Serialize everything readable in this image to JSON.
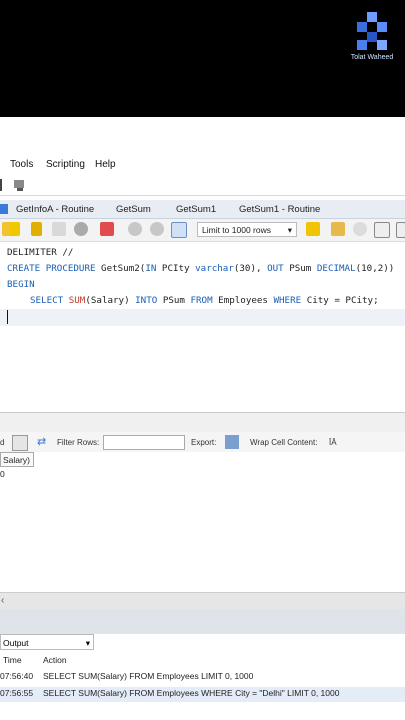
{
  "watermark": {
    "text": "Tolat Waheed"
  },
  "menu": {
    "items": [
      "Tools",
      "Scripting",
      "Help"
    ]
  },
  "tabs": [
    "GetInfoA - Routine",
    "GetSum",
    "GetSum1",
    "GetSum1 - Routine"
  ],
  "toolbar": {
    "limit_label": "Limit to 1000 rows",
    "limit_arrow": "▾"
  },
  "editor": {
    "line1": "DELIMITER //",
    "line2_kw1": "CREATE PROCEDURE",
    "line2_rest1": " GetSum2(",
    "line2_kw2": "IN",
    "line2_rest2": " PCIty ",
    "line2_kw3": "varchar",
    "line2_rest3": "(30), ",
    "line2_kw4": "OUT",
    "line2_rest4": " PSum ",
    "line2_kw5": "DECIMAL",
    "line2_rest5": "(10,2))",
    "line3": "BEGIN",
    "line4_kw1": "SELECT",
    "line4_fn": " SUM",
    "line4_rest1": "(Salary) ",
    "line4_kw2": "INTO",
    "line4_rest2": " PSum ",
    "line4_kw3": "FROM",
    "line4_rest3": " Employees ",
    "line4_kw4": "WHERE",
    "line4_rest4": " City = PCity;"
  },
  "results_bar": {
    "prefix": "d",
    "filter_label": "Filter Rows:",
    "export_label": "Export:",
    "wrap_label": "Wrap Cell Content:",
    "wrap_icon": "ĪĀ"
  },
  "grid": {
    "header": "Salary)",
    "cell": "0"
  },
  "output": {
    "select_label": "Output",
    "col_time": "Time",
    "col_action": "Action",
    "rows": [
      {
        "time": "07:56:40",
        "action": "SELECT SUM(Salary) FROM Employees LIMIT 0, 1000"
      },
      {
        "time": "07:56:55",
        "action": "SELECT SUM(Salary) FROM Employees WHERE City = \"Delhi\" LIMIT 0, 1000"
      }
    ]
  }
}
